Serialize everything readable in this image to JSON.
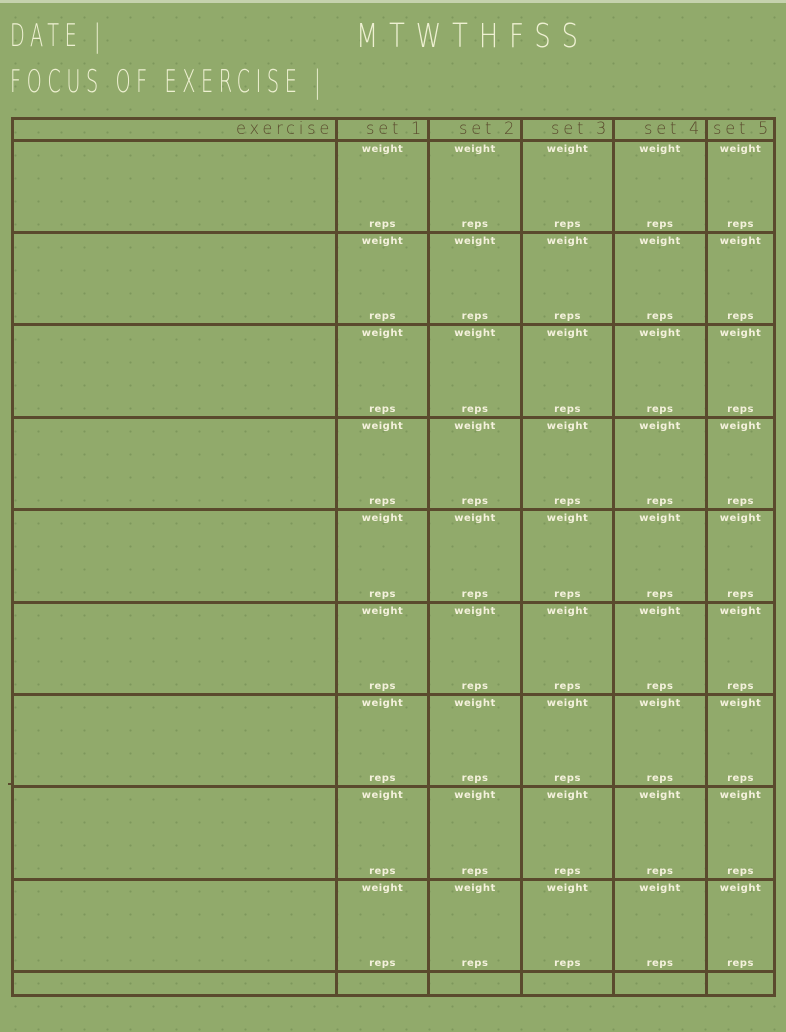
{
  "header": {
    "date_label": "DATE |",
    "focus_label": "FOCUS OF EXERCISE |",
    "days": "MTWTHFSS",
    "days_list": [
      "M",
      "T",
      "W",
      "TH",
      "F",
      "S",
      "S"
    ]
  },
  "table": {
    "columns": [
      "exercise",
      "set 1",
      "set 2",
      "set 3",
      "set 4",
      "set 5"
    ],
    "cell_top_label": "weight",
    "cell_bottom_label": "reps",
    "row_count": 9,
    "rows": [
      {
        "exercise": "",
        "sets": [
          "",
          "",
          "",
          "",
          ""
        ]
      },
      {
        "exercise": "",
        "sets": [
          "",
          "",
          "",
          "",
          ""
        ]
      },
      {
        "exercise": "",
        "sets": [
          "",
          "",
          "",
          "",
          ""
        ]
      },
      {
        "exercise": "",
        "sets": [
          "",
          "",
          "",
          "",
          ""
        ]
      },
      {
        "exercise": "",
        "sets": [
          "",
          "",
          "",
          "",
          ""
        ]
      },
      {
        "exercise": "",
        "sets": [
          "",
          "",
          "",
          "",
          ""
        ]
      },
      {
        "exercise": "",
        "sets": [
          "",
          "",
          "",
          "",
          ""
        ]
      },
      {
        "exercise": "",
        "sets": [
          "",
          "",
          "",
          "",
          ""
        ]
      },
      {
        "exercise": "",
        "sets": [
          "",
          "",
          "",
          "",
          ""
        ]
      }
    ],
    "footer_row": true
  },
  "colors": {
    "background": "#91aa6b",
    "grid_line": "#5a4a2d",
    "heading_text": "#eef0d2",
    "cell_label_text": "#f4f1dc"
  }
}
